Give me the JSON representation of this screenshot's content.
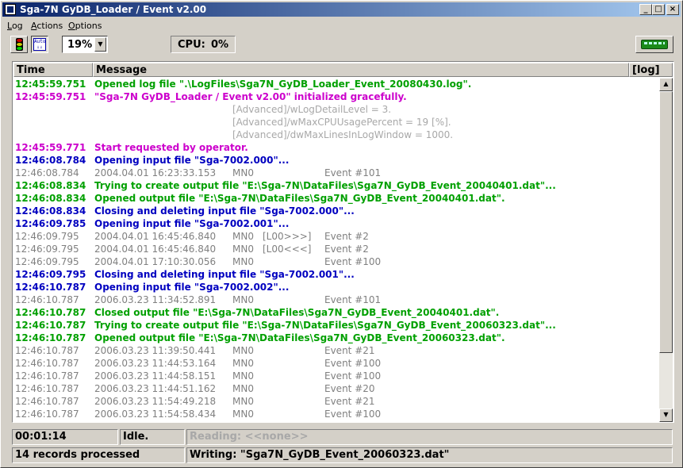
{
  "window": {
    "title": "Sga-7N GyDB_Loader / Event  v2.00",
    "minimize_glyph": "_",
    "maximize_glyph": "□",
    "close_glyph": "×"
  },
  "menu": {
    "items": [
      {
        "label": "Log",
        "underline": "L",
        "rest": "og"
      },
      {
        "label": "Actions",
        "underline": "A",
        "rest": "ctions"
      },
      {
        "label": "Options",
        "underline": "O",
        "rest": "ptions"
      }
    ]
  },
  "toolbar": {
    "start_icon": "traffic-light-icon",
    "auto_icon": "auto-scroll-icon",
    "auto_label": "Auto",
    "zoom_value": "19%",
    "cpu_label": "CPU:",
    "cpu_value": "0%",
    "train_icon": "train-icon"
  },
  "log": {
    "columns": {
      "time": "Time",
      "message": "Message",
      "log": "[log]"
    },
    "colors": {
      "green": "#00a000",
      "magenta": "#cc00cc",
      "blue": "#0000c0",
      "gray": "#808080",
      "lightgray": "#a8a8a8"
    },
    "rows": [
      {
        "time": "12:45:59.751",
        "message": "Opened log file \".\\LogFiles\\Sga7N_GyDB_Loader_Event_20080430.log\".",
        "color": "green",
        "bold": true
      },
      {
        "time": "12:45:59.751",
        "message": "\"Sga-7N GyDB_Loader / Event  v2.00\" initialized gracefully.",
        "color": "magenta",
        "bold": true
      },
      {
        "time": "",
        "message": "[Advanced]/wLogDetailLevel = 3.",
        "color": "lightgray",
        "bold": false,
        "indent": true
      },
      {
        "time": "",
        "message": "[Advanced]/wMaxCPUUsagePercent = 19 [%].",
        "color": "lightgray",
        "bold": false,
        "indent": true
      },
      {
        "time": "",
        "message": "[Advanced]/dwMaxLinesInLogWindow = 1000.",
        "color": "lightgray",
        "bold": false,
        "indent": true
      },
      {
        "time": "12:45:59.771",
        "message": "Start requested by operator.",
        "color": "magenta",
        "bold": true
      },
      {
        "time": "12:46:08.784",
        "message": "Opening input file \"Sga-7002.000\"...",
        "color": "blue",
        "bold": true
      },
      {
        "time": "12:46:08.784",
        "cols": [
          "2004.04.01 16:23:33.153",
          "MN0",
          "",
          "Event #101"
        ],
        "color": "gray",
        "bold": false
      },
      {
        "time": "12:46:08.834",
        "message": "Trying to create output file \"E:\\Sga-7N\\DataFiles\\Sga7N_GyDB_Event_20040401.dat\"...",
        "color": "green",
        "bold": true
      },
      {
        "time": "12:46:08.834",
        "message": "Opened output file \"E:\\Sga-7N\\DataFiles\\Sga7N_GyDB_Event_20040401.dat\".",
        "color": "green",
        "bold": true
      },
      {
        "time": "12:46:08.834",
        "message": "Closing and deleting input file \"Sga-7002.000\"...",
        "color": "blue",
        "bold": true
      },
      {
        "time": "12:46:09.785",
        "message": "Opening input file \"Sga-7002.001\"...",
        "color": "blue",
        "bold": true
      },
      {
        "time": "12:46:09.795",
        "cols": [
          "2004.04.01 16:45:46.840",
          "MN0",
          "[L00>>>]",
          "Event #2"
        ],
        "color": "gray",
        "bold": false
      },
      {
        "time": "12:46:09.795",
        "cols": [
          "2004.04.01 16:45:46.840",
          "MN0",
          "[L00<<<]",
          "Event #2"
        ],
        "color": "gray",
        "bold": false
      },
      {
        "time": "12:46:09.795",
        "cols": [
          "2004.04.01 17:10:30.056",
          "MN0",
          "",
          "Event #100"
        ],
        "color": "gray",
        "bold": false
      },
      {
        "time": "12:46:09.795",
        "message": "Closing and deleting input file \"Sga-7002.001\"...",
        "color": "blue",
        "bold": true
      },
      {
        "time": "12:46:10.787",
        "message": "Opening input file \"Sga-7002.002\"...",
        "color": "blue",
        "bold": true
      },
      {
        "time": "12:46:10.787",
        "cols": [
          "2006.03.23 11:34:52.891",
          "MN0",
          "",
          "Event #101"
        ],
        "color": "gray",
        "bold": false
      },
      {
        "time": "12:46:10.787",
        "message": "Closed output file \"E:\\Sga-7N\\DataFiles\\Sga7N_GyDB_Event_20040401.dat\".",
        "color": "green",
        "bold": true
      },
      {
        "time": "12:46:10.787",
        "message": "Trying to create output file \"E:\\Sga-7N\\DataFiles\\Sga7N_GyDB_Event_20060323.dat\"...",
        "color": "green",
        "bold": true
      },
      {
        "time": "12:46:10.787",
        "message": "Opened output file \"E:\\Sga-7N\\DataFiles\\Sga7N_GyDB_Event_20060323.dat\".",
        "color": "green",
        "bold": true
      },
      {
        "time": "12:46:10.787",
        "cols": [
          "2006.03.23 11:39:50.441",
          "MN0",
          "",
          "Event #21"
        ],
        "color": "gray",
        "bold": false
      },
      {
        "time": "12:46:10.787",
        "cols": [
          "2006.03.23 11:44:53.164",
          "MN0",
          "",
          "Event #100"
        ],
        "color": "gray",
        "bold": false
      },
      {
        "time": "12:46:10.787",
        "cols": [
          "2006.03.23 11:44:58.151",
          "MN0",
          "",
          "Event #100"
        ],
        "color": "gray",
        "bold": false
      },
      {
        "time": "12:46:10.787",
        "cols": [
          "2006.03.23 11:44:51.162",
          "MN0",
          "",
          "Event #20"
        ],
        "color": "gray",
        "bold": false
      },
      {
        "time": "12:46:10.787",
        "cols": [
          "2006.03.23 11:54:49.218",
          "MN0",
          "",
          "Event #21"
        ],
        "color": "gray",
        "bold": false
      },
      {
        "time": "12:46:10.787",
        "cols": [
          "2006.03.23 11:54:58.434",
          "MN0",
          "",
          "Event #100"
        ],
        "color": "gray",
        "bold": false
      }
    ]
  },
  "status": {
    "elapsed": "00:01:14",
    "state": "Idle.",
    "reading": "Reading: <<none>>",
    "records": "14 records processed",
    "writing": "Writing: \"Sga7N_GyDB_Event_20060323.dat\""
  }
}
